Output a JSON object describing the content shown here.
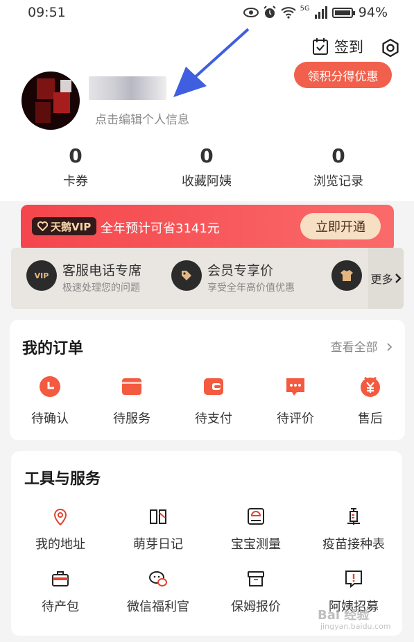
{
  "status_bar": {
    "time": "09:51",
    "network": "5G",
    "battery": "94%"
  },
  "header": {
    "signin_label": "签到",
    "promo_pill": "领积分得优惠"
  },
  "profile": {
    "edit_hint": "点击编辑个人信息"
  },
  "stats": [
    {
      "value": "0",
      "label": "卡券"
    },
    {
      "value": "0",
      "label": "收藏阿姨"
    },
    {
      "value": "0",
      "label": "浏览记录"
    }
  ],
  "vip": {
    "badge": "天鹅VIP",
    "saving_text": "全年预计可省3141元",
    "button": "立即开通"
  },
  "perks": {
    "items": [
      {
        "icon": "VIP",
        "title": "客服电话专席",
        "subtitle": "极速处理您的问题"
      },
      {
        "icon": "price-tag",
        "title": "会员专享价",
        "subtitle": "享受全年高价值优惠"
      }
    ],
    "more_label": "更多"
  },
  "orders": {
    "title": "我的订单",
    "view_all": "查看全部",
    "items": [
      {
        "label": "待确认",
        "icon": "clock-icon"
      },
      {
        "label": "待服务",
        "icon": "card-icon"
      },
      {
        "label": "待支付",
        "icon": "wallet-icon"
      },
      {
        "label": "待评价",
        "icon": "chat-icon"
      },
      {
        "label": "售后",
        "icon": "yuan-icon"
      }
    ]
  },
  "tools": {
    "title": "工具与服务",
    "items": [
      {
        "label": "我的地址",
        "icon": "location-icon"
      },
      {
        "label": "萌芽日记",
        "icon": "book-icon"
      },
      {
        "label": "宝宝测量",
        "icon": "scale-icon"
      },
      {
        "label": "疫苗接种表",
        "icon": "vaccine-icon"
      },
      {
        "label": "待产包",
        "icon": "bag-icon"
      },
      {
        "label": "微信福利官",
        "icon": "wechat-icon"
      },
      {
        "label": "保姆报价",
        "icon": "box-icon"
      },
      {
        "label": "阿姨招募",
        "icon": "notice-icon"
      }
    ]
  },
  "watermark": {
    "text": "Bai 经验",
    "sub": "jingyan.baidu.com"
  },
  "colors": {
    "accent": "#f0604c",
    "vip_red": "#f4464c",
    "order_red": "#f35a3f"
  }
}
